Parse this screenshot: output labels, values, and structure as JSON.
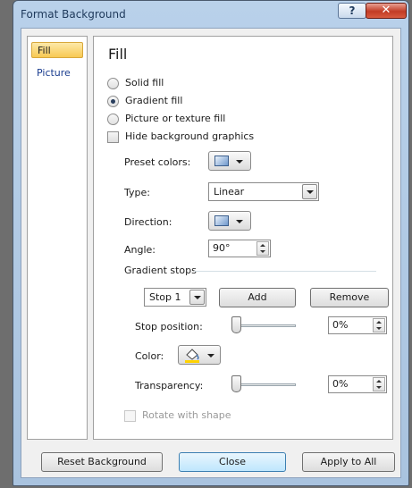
{
  "window": {
    "title": "Format Background",
    "help_glyph": "?",
    "close_glyph": "✕"
  },
  "nav": {
    "items": [
      {
        "label": "Fill",
        "selected": true
      },
      {
        "label": "Picture",
        "selected": false
      }
    ]
  },
  "fill": {
    "heading": "Fill",
    "options": [
      {
        "label": "Solid fill",
        "checked": false
      },
      {
        "label": "Gradient fill",
        "checked": true
      },
      {
        "label": "Picture or texture fill",
        "checked": false
      }
    ],
    "hide_graphics": {
      "label": "Hide background graphics",
      "checked": false
    },
    "preset_colors": {
      "label": "Preset colors:"
    },
    "type": {
      "label": "Type:",
      "value": "Linear"
    },
    "direction": {
      "label": "Direction:"
    },
    "angle": {
      "label": "Angle:",
      "value": "90°"
    },
    "gradient_stops": {
      "label": "Gradient stops",
      "stop_value": "Stop 1",
      "add_label": "Add",
      "remove_label": "Remove"
    },
    "stop_position": {
      "label": "Stop position:",
      "value": "0%",
      "slider_percent": 0
    },
    "color": {
      "label": "Color:",
      "accent": "#ffd200"
    },
    "transparency": {
      "label": "Transparency:",
      "value": "0%",
      "slider_percent": 0
    },
    "rotate_with_shape": {
      "label": "Rotate with shape",
      "checked": false,
      "enabled": false
    }
  },
  "footer": {
    "reset_label": "Reset Background",
    "close_label": "Close",
    "apply_all_label": "Apply to All"
  }
}
